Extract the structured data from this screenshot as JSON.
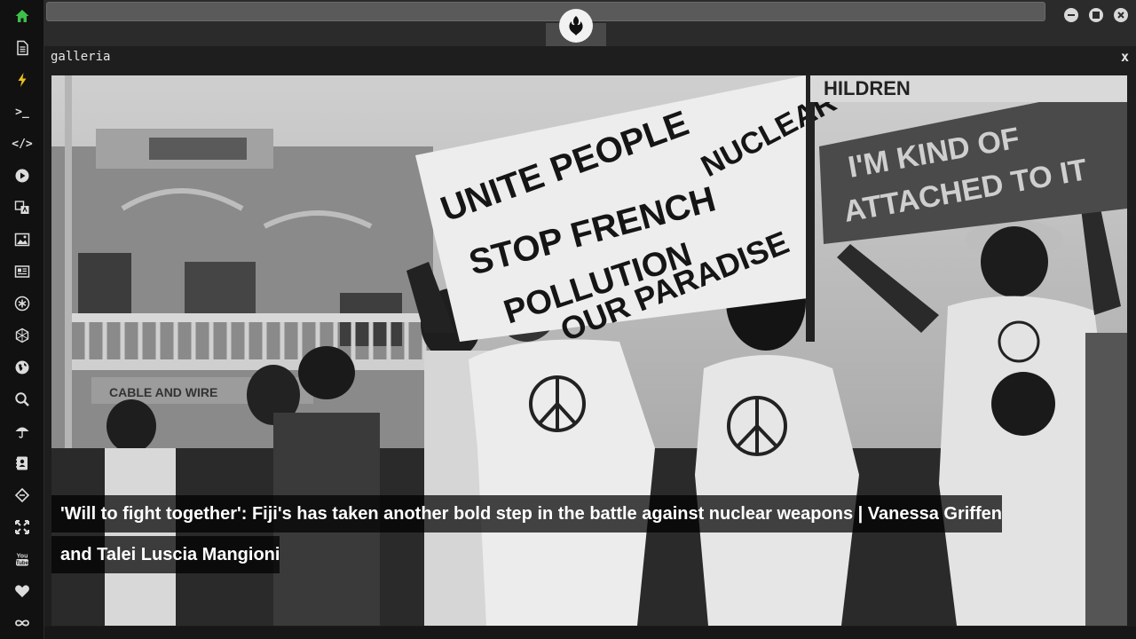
{
  "sidebar": {
    "items": [
      {
        "name": "home-icon"
      },
      {
        "name": "document-icon"
      },
      {
        "name": "lightning-icon"
      },
      {
        "name": "terminal-icon",
        "glyph": ">_"
      },
      {
        "name": "code-icon",
        "glyph": "</>"
      },
      {
        "name": "play-icon"
      },
      {
        "name": "translate-icon"
      },
      {
        "name": "image-icon"
      },
      {
        "name": "news-icon"
      },
      {
        "name": "asterisk-icon"
      },
      {
        "name": "hexagon-icon"
      },
      {
        "name": "globe-icon"
      },
      {
        "name": "search-icon"
      },
      {
        "name": "umbrella-icon"
      },
      {
        "name": "contact-icon"
      },
      {
        "name": "link-diamond-icon"
      },
      {
        "name": "expand-icon"
      },
      {
        "name": "youtube-icon",
        "glyph": "You\nTube"
      },
      {
        "name": "heart-icon"
      },
      {
        "name": "infinity-icon"
      }
    ]
  },
  "panel": {
    "title": "galleria",
    "close_label": "x"
  },
  "gallery": {
    "caption": "'Will to fight together': Fiji's has taken another bold step in the battle against nuclear weapons | Vanessa Griffen and Talei Luscia Mangioni",
    "photo_signs": {
      "main_line1": "UNITE PEOPLE",
      "main_line2": "STOP FRENCH",
      "main_line3": "NUCLEAR",
      "main_line4": "POLLUTION",
      "main_line5": "OUR PARADISE",
      "right_line1": "I'M KIND OF",
      "right_line2": "ATTACHED TO IT",
      "top_banner": "HILDREN",
      "building_sign": "CABLE AND WIRE"
    }
  },
  "colors": {
    "sidebar_bg": "#111111",
    "accent_green": "#3dbf4a",
    "accent_yellow": "#e8c21c",
    "icon_gray": "#dcdcdc"
  }
}
